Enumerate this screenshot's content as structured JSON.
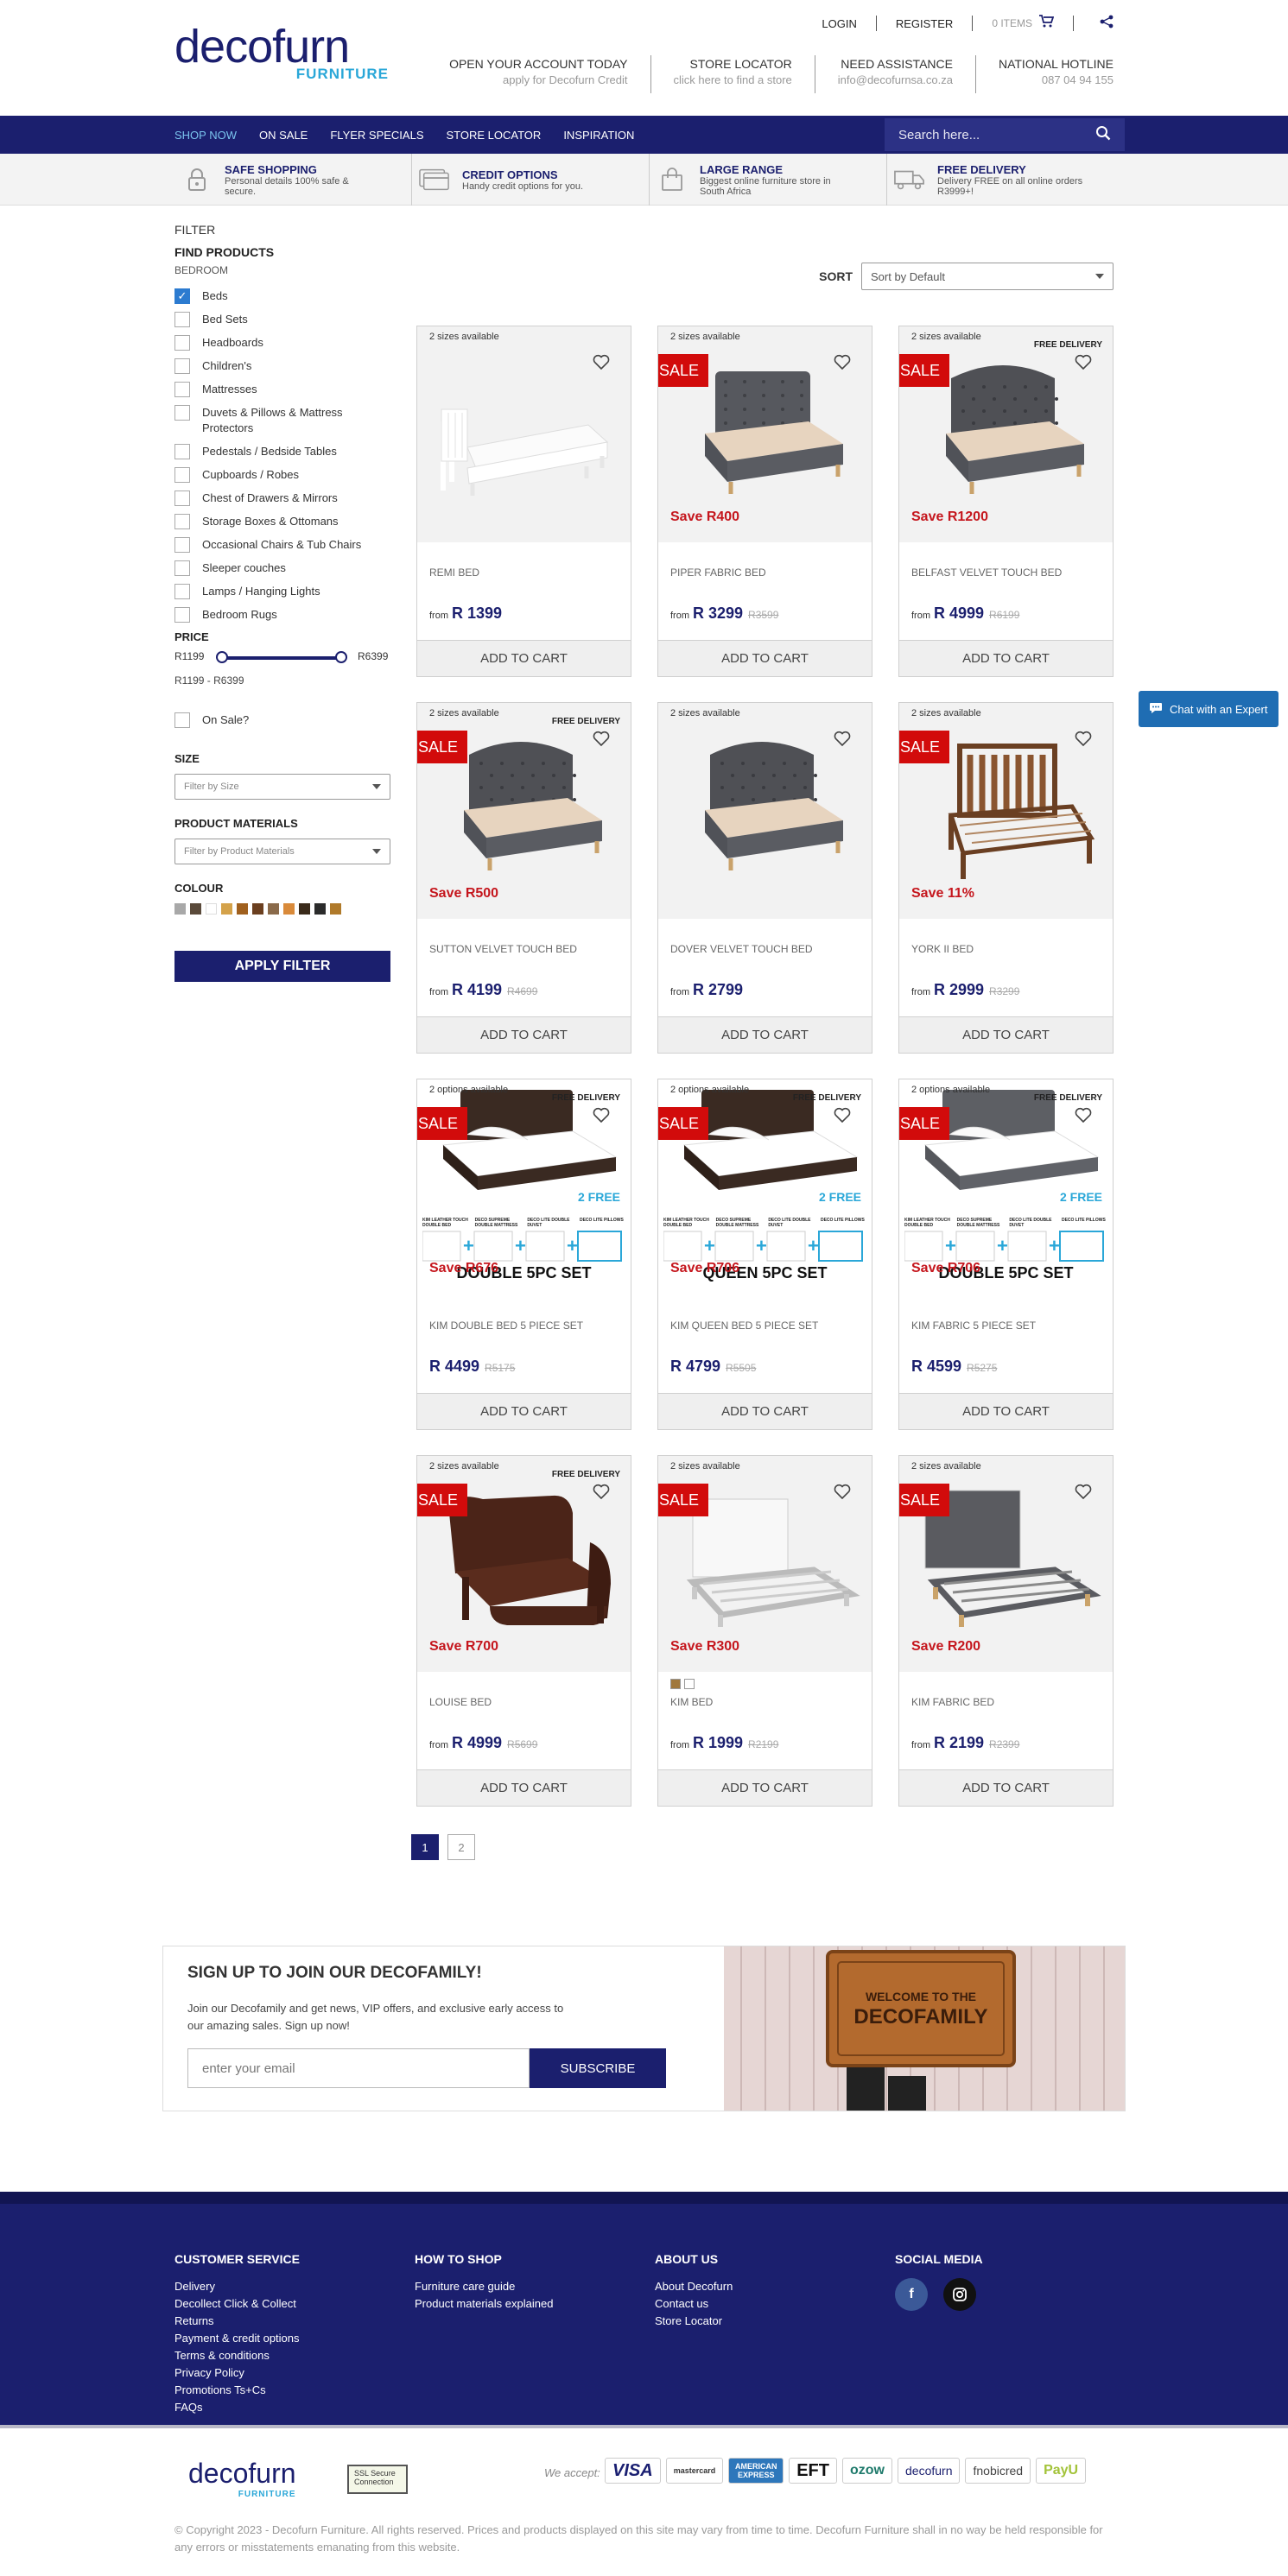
{
  "header": {
    "logo_main": "decofurn",
    "logo_sub": "FURNITURE",
    "login": "LOGIN",
    "register": "REGISTER",
    "cart_items": "0 ITEMS",
    "info": [
      {
        "title": "OPEN YOUR ACCOUNT TODAY",
        "sub": "apply for Decofurn Credit"
      },
      {
        "title": "STORE LOCATOR",
        "sub": "click here to find a store"
      },
      {
        "title": "NEED ASSISTANCE",
        "sub": "info@decofurnsa.co.za"
      },
      {
        "title": "NATIONAL HOTLINE",
        "sub": "087 04 94 155"
      }
    ]
  },
  "nav": {
    "items": [
      "SHOP NOW",
      "ON SALE",
      "FLYER SPECIALS",
      "STORE LOCATOR",
      "INSPIRATION"
    ],
    "search_placeholder": "Search here..."
  },
  "usp": [
    {
      "title": "SAFE SHOPPING",
      "sub": "Personal details 100% safe & secure.",
      "icon": "lock-icon"
    },
    {
      "title": "CREDIT OPTIONS",
      "sub": "Handy credit options for you.",
      "icon": "credit-card-icon"
    },
    {
      "title": "LARGE RANGE",
      "sub": "Biggest online furniture store in South Africa",
      "icon": "shopping-bag-icon"
    },
    {
      "title": "FREE DELIVERY",
      "sub": "Delivery FREE on all online orders R3999+!",
      "icon": "truck-icon"
    }
  ],
  "filter": {
    "heading": "FILTER",
    "find": "FIND PRODUCTS",
    "category": "BEDROOM",
    "categories": [
      {
        "label": "Beds",
        "checked": true
      },
      {
        "label": "Bed Sets",
        "checked": false
      },
      {
        "label": "Headboards",
        "checked": false
      },
      {
        "label": "Children's",
        "checked": false
      },
      {
        "label": "Mattresses",
        "checked": false
      },
      {
        "label": "Duvets & Pillows & Mattress Protectors",
        "checked": false
      },
      {
        "label": "Pedestals / Bedside Tables",
        "checked": false
      },
      {
        "label": "Cupboards / Robes",
        "checked": false
      },
      {
        "label": "Chest of Drawers & Mirrors",
        "checked": false
      },
      {
        "label": "Storage Boxes & Ottomans",
        "checked": false
      },
      {
        "label": "Occasional Chairs & Tub Chairs",
        "checked": false
      },
      {
        "label": "Sleeper couches",
        "checked": false
      },
      {
        "label": "Lamps / Hanging Lights",
        "checked": false
      },
      {
        "label": "Bedroom Rugs",
        "checked": false
      }
    ],
    "price_label": "PRICE",
    "price_min": "R1199",
    "price_max": "R6399",
    "price_range": "R1199 - R6399",
    "on_sale": "On Sale?",
    "size_label": "SIZE",
    "size_placeholder": "Filter by Size",
    "materials_label": "PRODUCT MATERIALS",
    "materials_placeholder": "Filter by Product Materials",
    "colour_label": "COLOUR",
    "colours": [
      "#a8a8a8",
      "#5a4a3a",
      "#ffffff",
      "#d4a24a",
      "#a0601e",
      "#6b3f1f",
      "#8a6a4a",
      "#d98a3a",
      "#3a2a1a",
      "#2b2b2b",
      "#b07a2a"
    ],
    "apply": "APPLY FILTER"
  },
  "sort": {
    "label": "SORT",
    "value": "Sort by Default"
  },
  "products": [
    {
      "name": "REMI BED",
      "sizes": "2 sizes available",
      "from": "from",
      "price": "R 1399",
      "was": "",
      "sale": false,
      "save": "",
      "free_delivery": false,
      "kind": "white"
    },
    {
      "name": "PIPER FABRIC BED",
      "sizes": "2 sizes available",
      "from": "from",
      "price": "R 3299",
      "was": "R3599",
      "sale": true,
      "save": "Save R400",
      "free_delivery": false,
      "kind": "grey"
    },
    {
      "name": "BELFAST VELVET TOUCH BED",
      "sizes": "2 sizes available",
      "from": "from",
      "price": "R 4999",
      "was": "R6199",
      "sale": true,
      "save": "Save R1200",
      "free_delivery": true,
      "kind": "tufted"
    },
    {
      "name": "SUTTON VELVET TOUCH BED",
      "sizes": "2 sizes available",
      "from": "from",
      "price": "R 4199",
      "was": "R4699",
      "sale": true,
      "save": "Save R500",
      "free_delivery": true,
      "kind": "tufted"
    },
    {
      "name": "DOVER VELVET TOUCH BED",
      "sizes": "2 sizes available",
      "from": "from",
      "price": "R 2799",
      "was": "",
      "sale": false,
      "save": "",
      "free_delivery": false,
      "kind": "tufted"
    },
    {
      "name": "YORK II BED",
      "sizes": "2 sizes available",
      "from": "from",
      "price": "R 2999",
      "was": "R3299",
      "sale": true,
      "save": "Save 11%",
      "free_delivery": false,
      "kind": "wood"
    },
    {
      "name": "KIM DOUBLE BED 5 PIECE SET",
      "sizes": "2 options available",
      "from": "",
      "price": "R 4499",
      "was": "R5175",
      "sale": true,
      "save": "Save R676",
      "free_delivery": true,
      "kind": "set",
      "set_title": "DOUBLE 5PC SET"
    },
    {
      "name": "KIM QUEEN BED 5 PIECE SET",
      "sizes": "2 options available",
      "from": "",
      "price": "R 4799",
      "was": "R5505",
      "sale": true,
      "save": "Save R706",
      "free_delivery": true,
      "kind": "set",
      "set_title": "QUEEN 5PC SET"
    },
    {
      "name": "KIM FABRIC 5 PIECE SET",
      "sizes": "2 options available",
      "from": "",
      "price": "R 4599",
      "was": "R5275",
      "sale": true,
      "save": "Save R706",
      "free_delivery": true,
      "kind": "set2",
      "set_title": "DOUBLE 5PC SET"
    },
    {
      "name": "LOUISE BED",
      "sizes": "2 sizes available",
      "from": "from",
      "price": "R 4999",
      "was": "R5699",
      "sale": true,
      "save": "Save R700",
      "free_delivery": true,
      "kind": "sleigh"
    },
    {
      "name": "KIM BED",
      "sizes": "2 sizes available",
      "from": "from",
      "price": "R 1999",
      "was": "R2199",
      "sale": true,
      "save": "Save R300",
      "free_delivery": false,
      "kind": "whiteframe",
      "swatches": [
        "#a0783c",
        "#ffffff"
      ]
    },
    {
      "name": "KIM FABRIC BED",
      "sizes": "2 sizes available",
      "from": "from",
      "price": "R 2199",
      "was": "R2399",
      "sale": true,
      "save": "Save R200",
      "free_delivery": false,
      "kind": "greyframe"
    }
  ],
  "product_ui": {
    "add_to_cart": "ADD TO CART",
    "sale": "SALE",
    "free_delivery": "FREE DELIVERY",
    "set_labels": [
      "KIM LEATHER TOUCH DOUBLE BED",
      "DECO SUPREME DOUBLE MATTRESS",
      "DECO LITE DOUBLE DUVET",
      "DECO LITE PILLOWS"
    ],
    "free_badge": "2 FREE"
  },
  "pagination": [
    "1",
    "2"
  ],
  "chat": "Chat with an Expert",
  "newsletter": {
    "title": "SIGN UP TO JOIN OUR DECOFAMILY!",
    "text": "Join our Decofamily and get news, VIP offers, and exclusive early access to our amazing sales. Sign up now!",
    "placeholder": "enter your email",
    "button": "SUBSCRIBE",
    "mat_line1": "WELCOME TO THE",
    "mat_line2": "DECOFAMILY"
  },
  "footer": {
    "cols": [
      {
        "title": "CUSTOMER SERVICE",
        "links": [
          "Delivery",
          "Decollect Click & Collect",
          "Returns",
          "Payment & credit options",
          "Terms & conditions",
          "Privacy Policy",
          "Promotions Ts+Cs",
          "FAQs"
        ]
      },
      {
        "title": "HOW TO SHOP",
        "links": [
          "Furniture care guide",
          "Product materials explained"
        ]
      },
      {
        "title": "ABOUT US",
        "links": [
          "About Decofurn",
          "Contact us",
          "Store Locator"
        ]
      },
      {
        "title": "SOCIAL MEDIA",
        "links": []
      }
    ],
    "ssl": "SSL Secure Connection",
    "accept": "We accept:",
    "payments": [
      "VISA",
      "mastercard",
      "AMERICAN EXPRESS",
      "EFT",
      "ozow",
      "decofurn",
      "fnobicred",
      "PayU"
    ],
    "copyright": "© Copyright 2023 - Decofurn Furniture. All rights reserved. Prices and products displayed on this site may vary from time to time. Decofurn Furniture shall in no way be held responsible for any errors or misstatements emanating from this website."
  },
  "colors": {
    "brand": "#1b1f6e",
    "accent": "#2aa7d8",
    "sale": "#d20b0b"
  }
}
